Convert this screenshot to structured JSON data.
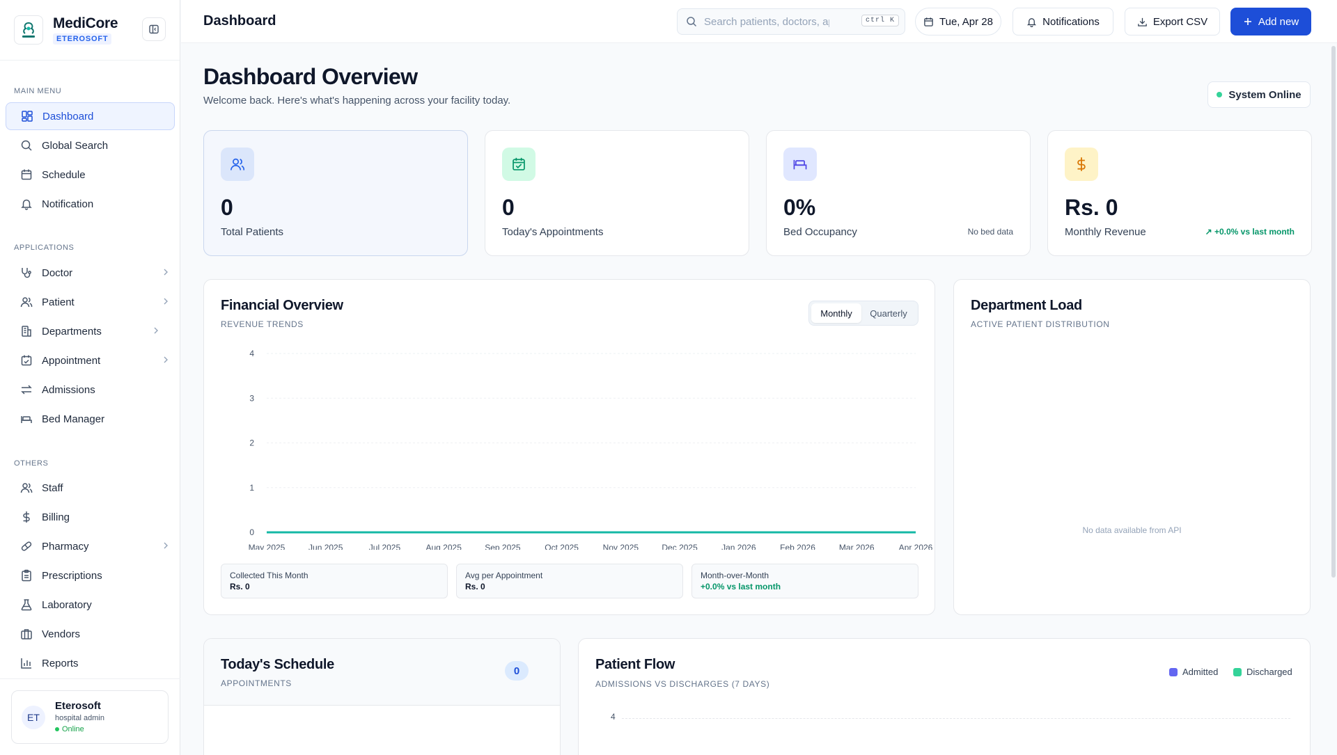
{
  "brand": {
    "name": "MediCore",
    "org": "ETEROSOFT"
  },
  "sidebar": {
    "sections": {
      "main": "MAIN MENU",
      "apps": "APPLICATIONS",
      "others": "OTHERS"
    },
    "main_items": [
      {
        "label": "Dashboard",
        "icon": "dashboard-icon",
        "active": true
      },
      {
        "label": "Global Search",
        "icon": "search-icon"
      },
      {
        "label": "Schedule",
        "icon": "calendar-icon"
      },
      {
        "label": "Notification",
        "icon": "bell-icon"
      }
    ],
    "app_items": [
      {
        "label": "Doctor",
        "icon": "stethoscope-icon",
        "has_submenu": true
      },
      {
        "label": "Patient",
        "icon": "users-icon",
        "has_submenu": true
      },
      {
        "label": "Departments",
        "icon": "building-icon",
        "has_submenu": true
      },
      {
        "label": "Appointment",
        "icon": "calendar-check-icon",
        "has_submenu": true
      },
      {
        "label": "Admissions",
        "icon": "swap-icon"
      },
      {
        "label": "Bed Manager",
        "icon": "bed-icon"
      }
    ],
    "other_items": [
      {
        "label": "Staff",
        "icon": "users-icon"
      },
      {
        "label": "Billing",
        "icon": "dollar-icon"
      },
      {
        "label": "Pharmacy",
        "icon": "pill-icon",
        "has_submenu": true
      },
      {
        "label": "Prescriptions",
        "icon": "clipboard-icon"
      },
      {
        "label": "Laboratory",
        "icon": "flask-icon"
      },
      {
        "label": "Vendors",
        "icon": "briefcase-icon"
      },
      {
        "label": "Reports",
        "icon": "bar-chart-icon"
      }
    ],
    "user": {
      "initials": "ET",
      "name": "Eterosoft",
      "role": "hospital admin",
      "status": "Online"
    }
  },
  "topbar": {
    "title": "Dashboard",
    "search_placeholder": "Search patients, doctors, appointments...",
    "shortcut": "ctrl K",
    "date": "Tue, Apr 28",
    "notifications": "Notifications",
    "export": "Export CSV",
    "add": "Add new"
  },
  "header": {
    "title": "Dashboard Overview",
    "subtitle": "Welcome back. Here's what's happening across your facility today.",
    "status": "System Online"
  },
  "stats": [
    {
      "value": "0",
      "label": "Total Patients",
      "note": "",
      "icon": "users-icon"
    },
    {
      "value": "0",
      "label": "Today's Appointments",
      "note": "",
      "icon": "calendar-check-icon"
    },
    {
      "value": "0%",
      "label": "Bed Occupancy",
      "note": "No bed data",
      "icon": "bed-icon"
    },
    {
      "value": "Rs. 0",
      "label": "Monthly Revenue",
      "note": "+0.0% vs last month",
      "icon": "dollar-icon"
    }
  ],
  "financial": {
    "title": "Financial Overview",
    "subtitle": "REVENUE TRENDS",
    "toggle": [
      "Monthly",
      "Quarterly"
    ],
    "mini": [
      {
        "label": "Collected This Month",
        "value": "Rs. 0"
      },
      {
        "label": "Avg per Appointment",
        "value": "Rs. 0"
      },
      {
        "label": "Month-over-Month",
        "value": "+0.0% vs last month"
      }
    ]
  },
  "department": {
    "title": "Department Load",
    "subtitle": "ACTIVE PATIENT DISTRIBUTION",
    "empty": "No data available from API"
  },
  "schedule": {
    "title": "Today's Schedule",
    "subtitle": "APPOINTMENTS",
    "count": "0"
  },
  "flow": {
    "title": "Patient Flow",
    "subtitle": "ADMISSIONS VS DISCHARGES (7 DAYS)",
    "legend": [
      {
        "label": "Admitted",
        "color": "#6366f1"
      },
      {
        "label": "Discharged",
        "color": "#34d399"
      }
    ],
    "ytick_top": "4"
  },
  "chart_data": {
    "type": "line",
    "categories": [
      "May 2025",
      "Jun 2025",
      "Jul 2025",
      "Aug 2025",
      "Sep 2025",
      "Oct 2025",
      "Nov 2025",
      "Dec 2025",
      "Jan 2026",
      "Feb 2026",
      "Mar 2026",
      "Apr 2026"
    ],
    "series": [
      {
        "values": [
          0,
          0,
          0,
          0,
          0,
          0,
          0,
          0,
          0,
          0,
          0,
          0
        ],
        "color": "#14b8a6"
      }
    ],
    "yticks": [
      0,
      1,
      2,
      3,
      4
    ],
    "ylim": [
      0,
      4
    ],
    "grid": true,
    "title": "",
    "xlabel": "",
    "ylabel": ""
  }
}
